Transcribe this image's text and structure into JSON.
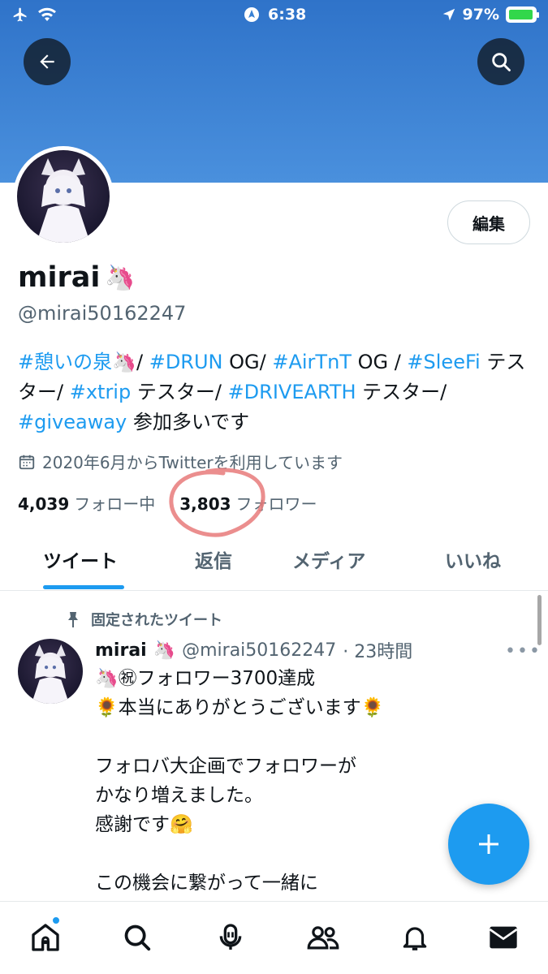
{
  "status_bar": {
    "time": "6:38",
    "battery": "97%"
  },
  "profile": {
    "name": "mirai",
    "handle": "@mirai50162247",
    "edit_label": "編集",
    "bio": [
      {
        "text": "#憩いの泉",
        "tag": true
      },
      {
        "text": "🦄/ ",
        "tag": false
      },
      {
        "text": "#DRUN",
        "tag": true
      },
      {
        "text": " OG/ ",
        "tag": false
      },
      {
        "text": "#AirTnT",
        "tag": true
      },
      {
        "text": " OG / ",
        "tag": false
      },
      {
        "text": "#SleeFi",
        "tag": true
      },
      {
        "text": " テスター/ ",
        "tag": false
      },
      {
        "text": "#xtrip",
        "tag": true
      },
      {
        "text": " テスター/ ",
        "tag": false
      },
      {
        "text": "#DRIVEARTH",
        "tag": true
      },
      {
        "text": " テスター/ ",
        "tag": false
      },
      {
        "text": "#giveaway",
        "tag": true
      },
      {
        "text": " 参加多いです",
        "tag": false
      }
    ],
    "joined": "2020年6月からTwitterを利用しています",
    "following_count": "4,039",
    "following_label": "フォロー中",
    "followers_count": "3,803",
    "followers_label": "フォロワー"
  },
  "tabs": [
    "ツイート",
    "返信",
    "メディア",
    "いいね"
  ],
  "tweet": {
    "pinned_label": "固定されたツイート",
    "name": "mirai",
    "handle": "@mirai50162247",
    "time": "· 23時間",
    "body": "🦄㊗フォロワー3700達成\n🌻本当にありがとうございます🌻\n\nフォロバ大企画でフォロワーが\nかなり増えました。\n感謝です🤗\n\nこの機会に繋がって一緒に\n爆伸びしましょう🔥"
  },
  "colors": {
    "accent": "#1d9bf0",
    "banner": "#3a82d4",
    "annotation": "#e87a7a"
  },
  "bottom_nav": [
    "home-icon",
    "search-icon",
    "spaces-icon",
    "communities-icon",
    "notifications-icon",
    "messages-icon"
  ]
}
